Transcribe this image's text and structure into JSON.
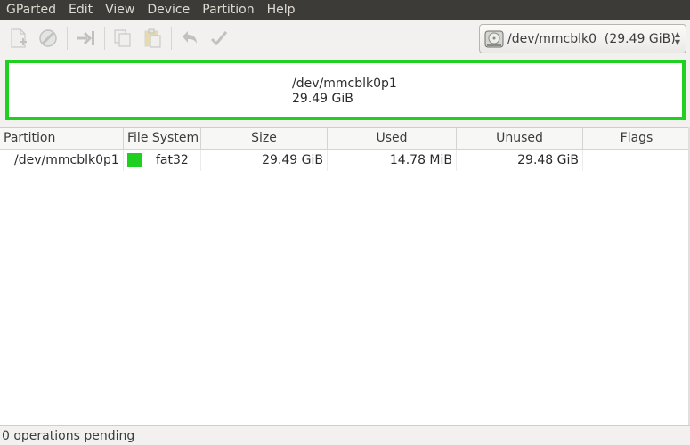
{
  "menubar": {
    "items": [
      "GParted",
      "Edit",
      "View",
      "Device",
      "Partition",
      "Help"
    ]
  },
  "toolbar": {
    "buttons": [
      "new-partition-icon",
      "delete-icon",
      "resize-move-icon",
      "copy-icon",
      "paste-icon",
      "undo-icon",
      "apply-icon"
    ],
    "device_selector": {
      "value": "/dev/mmcblk0  (29.49 GiB)"
    }
  },
  "partition_map": {
    "name": "/dev/mmcblk0p1",
    "size": "29.49 GiB",
    "color": "#20d020"
  },
  "table": {
    "headers": [
      "Partition",
      "File System",
      "Size",
      "Used",
      "Unused",
      "Flags"
    ],
    "rows": [
      {
        "partition": "/dev/mmcblk0p1",
        "filesystem": "fat32",
        "fs_color": "#20d020",
        "size": "29.49 GiB",
        "used": "14.78 MiB",
        "unused": "29.48 GiB",
        "flags": ""
      }
    ]
  },
  "status": {
    "text": "0 operations pending"
  }
}
